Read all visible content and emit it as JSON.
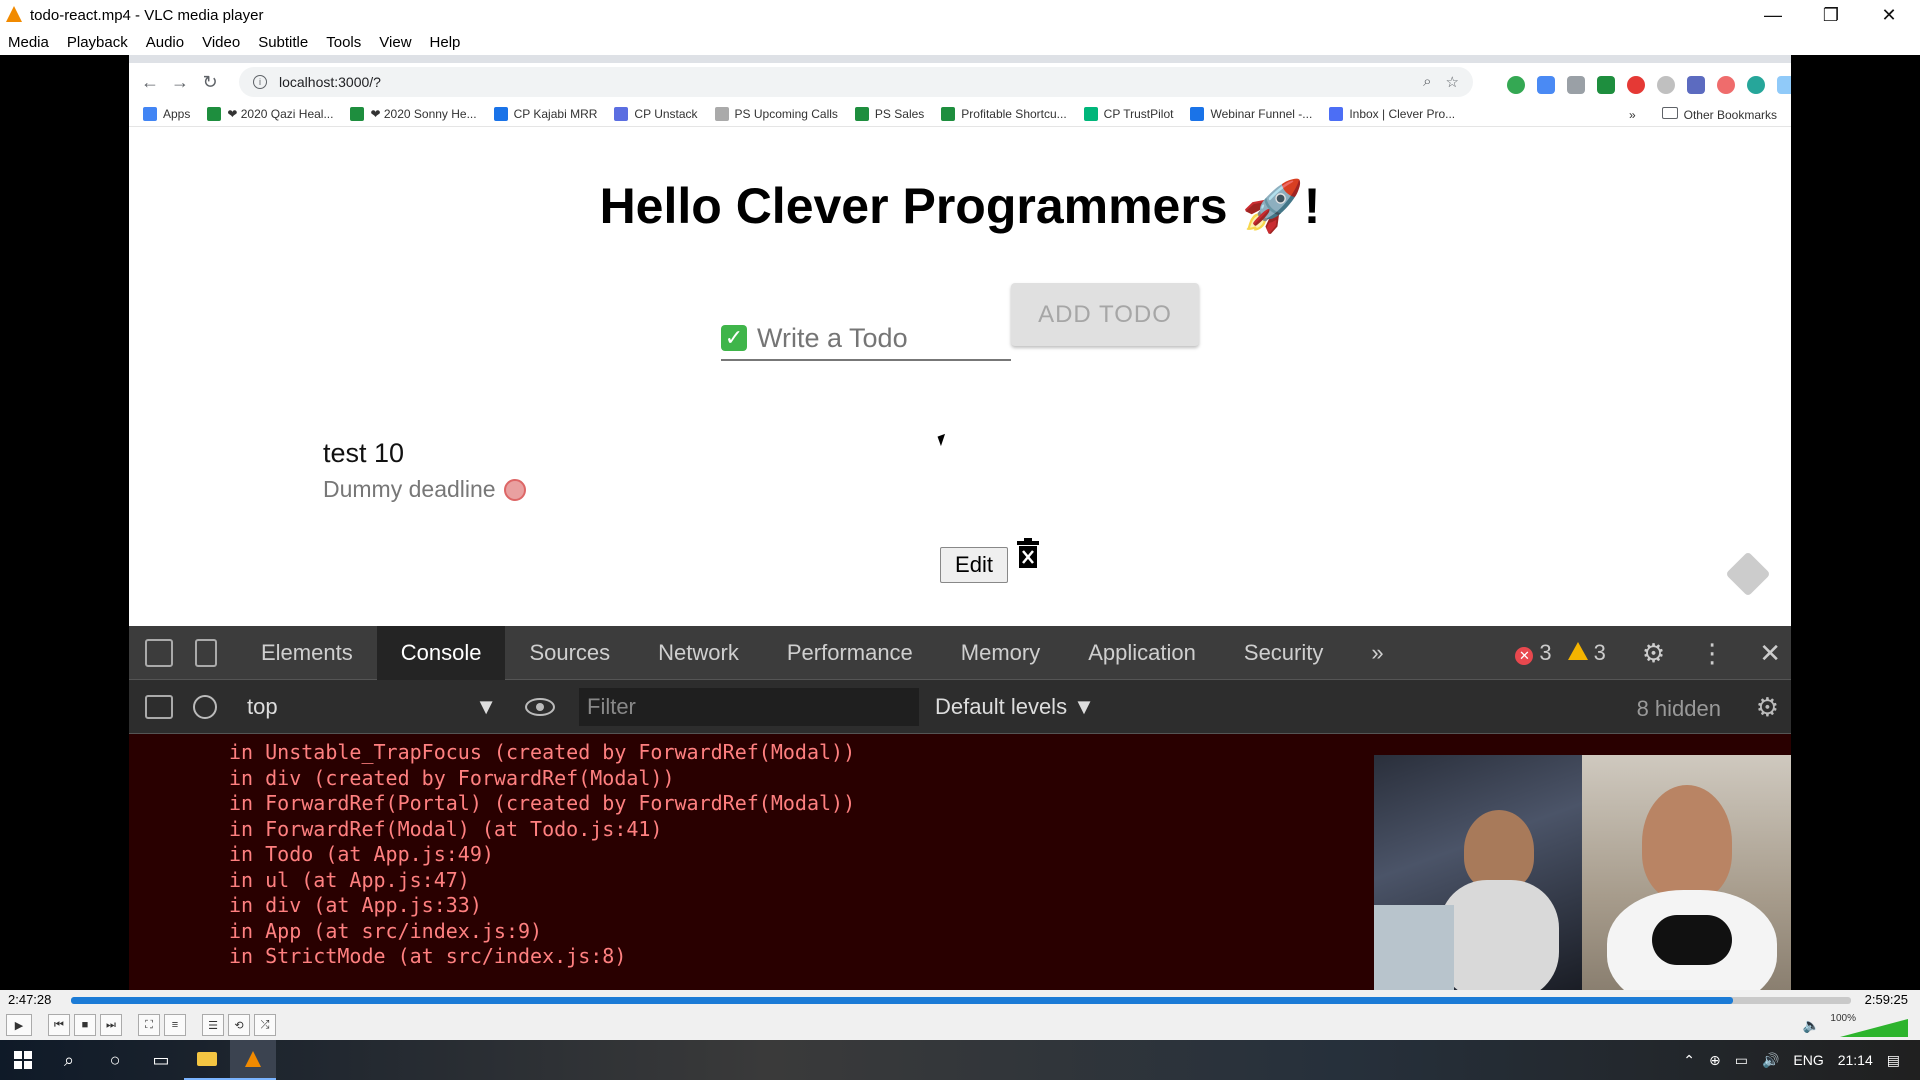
{
  "window": {
    "title": "todo-react.mp4 - VLC media player",
    "controls": [
      "—",
      "❐",
      "✕"
    ]
  },
  "menu": [
    "Media",
    "Playback",
    "Audio",
    "Video",
    "Subtitle",
    "Tools",
    "View",
    "Help"
  ],
  "browser": {
    "url": "localhost:3000/?",
    "bookmarks": [
      {
        "label": "Apps",
        "color": "#4285f4"
      },
      {
        "label": "❤ 2020 Qazi Heal...",
        "color": "#1e8e3e"
      },
      {
        "label": "❤ 2020 Sonny He...",
        "color": "#1e8e3e"
      },
      {
        "label": "CP Kajabi MRR",
        "color": "#1a73e8"
      },
      {
        "label": "CP Unstack",
        "color": "#5b6ee1"
      },
      {
        "label": "PS Upcoming Calls",
        "color": "#aaaaaa"
      },
      {
        "label": "PS Sales",
        "color": "#1e8e3e"
      },
      {
        "label": "Profitable Shortcu...",
        "color": "#1e8e3e"
      },
      {
        "label": "CP TrustPilot",
        "color": "#00b67a"
      },
      {
        "label": "Webinar Funnel -...",
        "color": "#1a73e8"
      },
      {
        "label": "Inbox | Clever Pro...",
        "color": "#4c6ef5"
      }
    ],
    "more_bookmarks": "»",
    "other_bookmarks": "Other Bookmarks"
  },
  "app": {
    "heading": "Hello Clever Programmers 🚀!",
    "input_placeholder": "Write a Todo",
    "add_button": "ADD TODO",
    "todo_item": {
      "text": "test 10",
      "deadline": "Dummy deadline"
    },
    "edit_button": "Edit"
  },
  "devtools": {
    "tabs": [
      "Elements",
      "Console",
      "Sources",
      "Network",
      "Performance",
      "Memory",
      "Application",
      "Security"
    ],
    "active_tab": "Console",
    "more": "»",
    "error_count": "3",
    "warning_count": "3",
    "context": "top",
    "filter_placeholder": "Filter",
    "levels": "Default levels ▼",
    "hidden": "8 hidden",
    "console_lines": [
      "in Unstable_TrapFocus (created by ForwardRef(Modal))",
      "in div (created by ForwardRef(Modal))",
      "in ForwardRef(Portal) (created by ForwardRef(Modal))",
      "in ForwardRef(Modal) (at Todo.js:41)",
      "in Todo (at App.js:49)",
      "in ul (at App.js:47)",
      "in div (at App.js:33)",
      "in App (at src/index.js:9)",
      "in StrictMode (at src/index.js:8)"
    ]
  },
  "player": {
    "elapsed": "2:47:28",
    "total": "2:59:25",
    "progress_fraction": 0.9336,
    "volume": "100%"
  },
  "taskbar": {
    "language": "ENG",
    "clock": "21:14"
  }
}
